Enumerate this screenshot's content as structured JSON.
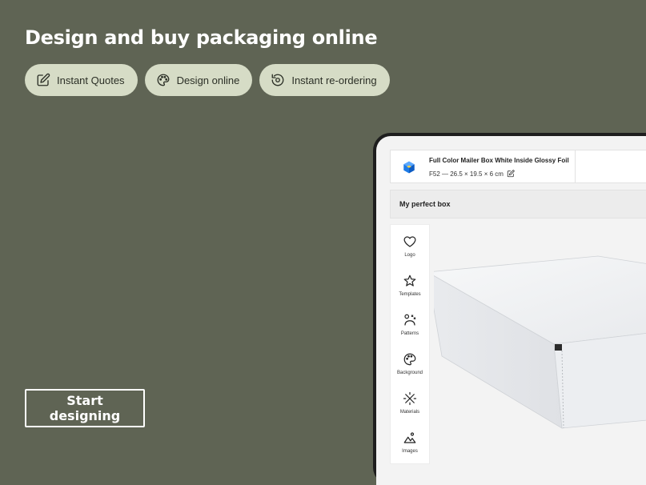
{
  "hero": {
    "headline": "Design and buy packaging online",
    "chips": [
      {
        "label": "Instant Quotes",
        "icon": "edit-icon"
      },
      {
        "label": "Design online",
        "icon": "palette-icon"
      },
      {
        "label": "Instant re-ordering",
        "icon": "reorder-icon"
      }
    ],
    "cta_label": "Start designing"
  },
  "editor": {
    "product_title": "Full Color Mailer Box White Inside Glossy Foil",
    "product_spec": "F52 — 26.5 × 19.5 × 6 cm",
    "design_name": "My perfect box",
    "tools": [
      {
        "label": "Logo",
        "icon": "heart-icon"
      },
      {
        "label": "Templates",
        "icon": "star-icon"
      },
      {
        "label": "Patterns",
        "icon": "patterns-icon"
      },
      {
        "label": "Background",
        "icon": "palette-icon"
      },
      {
        "label": "Materials",
        "icon": "materials-icon"
      },
      {
        "label": "Images",
        "icon": "image-icon"
      }
    ]
  },
  "colors": {
    "background": "#5f6454",
    "chip": "#d6dcc6",
    "accent_cube": "#1e7be6"
  }
}
